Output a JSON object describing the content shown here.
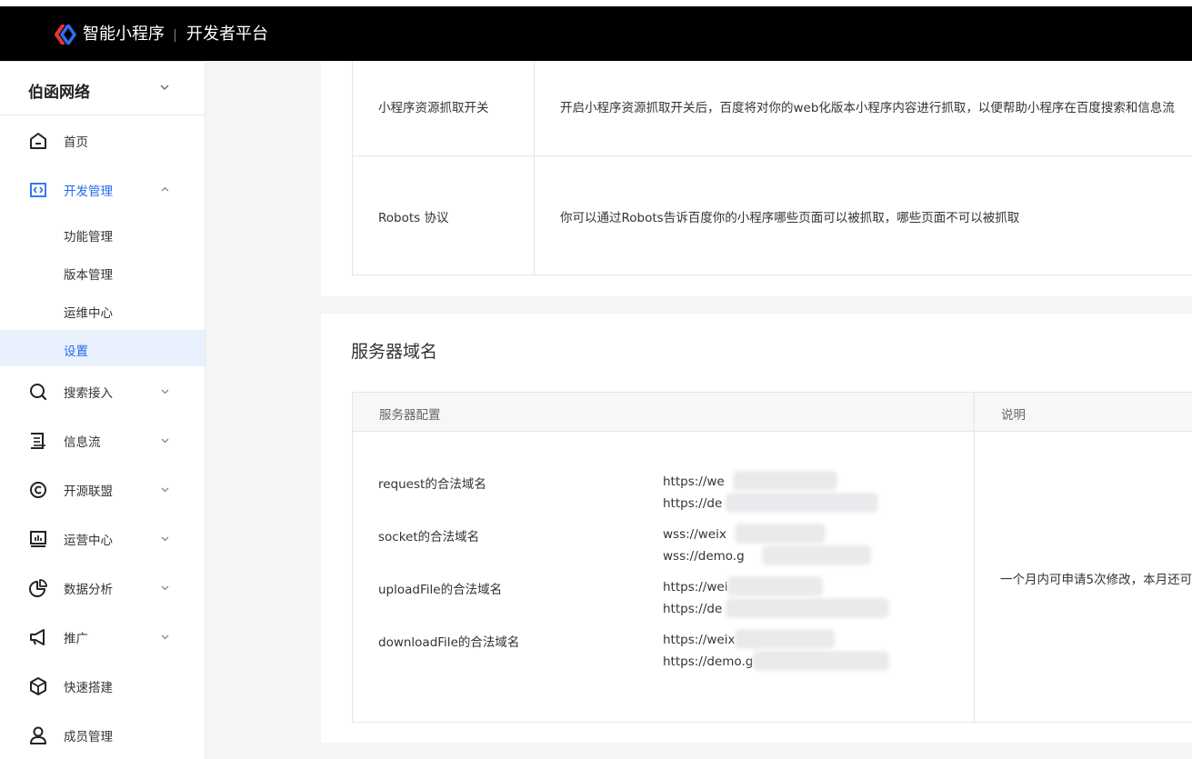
{
  "header": {
    "brand": "智能小程序",
    "subtitle": "开发者平台"
  },
  "sidebar": {
    "org_name": "伯函网络",
    "items": [
      {
        "label": "首页",
        "icon": "home-icon"
      },
      {
        "label": "开发管理",
        "icon": "code-icon",
        "expanded": true
      },
      {
        "label": "功能管理"
      },
      {
        "label": "版本管理"
      },
      {
        "label": "运维中心"
      },
      {
        "label": "设置",
        "selected": true
      },
      {
        "label": "搜索接入",
        "icon": "search-icon"
      },
      {
        "label": "信息流",
        "icon": "feed-icon"
      },
      {
        "label": "开源联盟",
        "icon": "copyright-icon"
      },
      {
        "label": "运营中心",
        "icon": "chart-icon"
      },
      {
        "label": "数据分析",
        "icon": "pie-chart-icon"
      },
      {
        "label": "推广",
        "icon": "megaphone-icon"
      },
      {
        "label": "快速搭建",
        "icon": "cube-icon"
      },
      {
        "label": "成员管理",
        "icon": "user-icon"
      }
    ]
  },
  "crawl_table": {
    "rows": [
      {
        "name": "小程序资源抓取开关",
        "desc": "开启小程序资源抓取开关后，百度将对你的web化版本小程序内容进行抓取，以便帮助小程序在百度搜索和信息流"
      },
      {
        "name": "Robots 协议",
        "desc": "你可以通过Robots告诉百度你的小程序哪些页面可以被抓取，哪些页面不可以被抓取"
      }
    ]
  },
  "server_domain": {
    "title": "服务器域名",
    "col_config": "服务器配置",
    "col_note": "说明",
    "rows": [
      {
        "label": "request的合法域名",
        "url1": "https://we",
        "url2": "https://de"
      },
      {
        "label": "socket的合法域名",
        "url1": "wss://weix",
        "url2": "wss://demo.g"
      },
      {
        "label": "uploadFile的合法域名",
        "url1": "https://wei",
        "url2": "https://de"
      },
      {
        "label": "downloadFile的合法域名",
        "url1": "https://weix",
        "url2": "https://demo.g"
      }
    ],
    "note": "一个月内可申请5次修改，本月还可"
  },
  "colors": {
    "accent": "#2468f2",
    "header_bg": "#000000",
    "logo_red": "#e6372f",
    "logo_blue": "#2f6cf6"
  }
}
